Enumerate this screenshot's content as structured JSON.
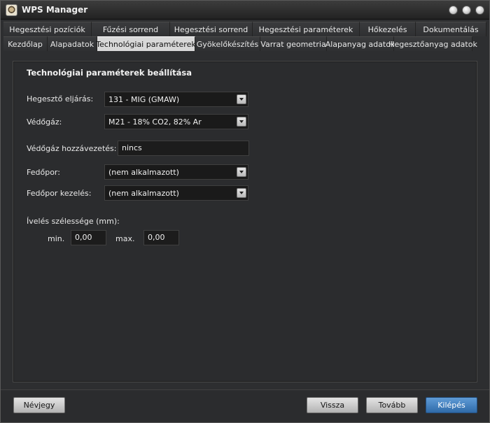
{
  "window": {
    "title": "WPS Manager"
  },
  "tabs_row1": [
    "Hegesztési pozíciók",
    "Fűzési sorrend",
    "Hegesztési sorrend",
    "Hegesztési paraméterek",
    "Hőkezelés",
    "Dokumentálás"
  ],
  "tabs_row2": [
    "Kezdőlap",
    "Alapadatok",
    "Technológiai paraméterek",
    "Gyökelőkészítés",
    "Varrat geometria",
    "Alapanyag adatok",
    "Hegesztőanyag adatok"
  ],
  "active_tab": "Technológiai paraméterek",
  "form": {
    "section_title": "Technológiai paraméterek beállítása",
    "process_label": "Hegesztő eljárás:",
    "process_value": "131 - MIG (GMAW)",
    "gas_label": "Védőgáz:",
    "gas_value": "M21 - 18% CO2, 82% Ar",
    "gas_supply_label": "Védőgáz hozzávezetés:",
    "gas_supply_value": "nincs",
    "flux_label": "Fedőpor:",
    "flux_value": "(nem alkalmazott)",
    "flux_handling_label": "Fedőpor kezelés:",
    "flux_handling_value": "(nem alkalmazott)",
    "arc_width_label": "Ívelés szélessége (mm):",
    "min_label": "min.",
    "min_value": "0,00",
    "max_label": "max.",
    "max_value": "0,00"
  },
  "footer": {
    "about_label": "Névjegy",
    "back_label": "Vissza",
    "next_label": "Tovább",
    "exit_label": "Kilépés"
  }
}
